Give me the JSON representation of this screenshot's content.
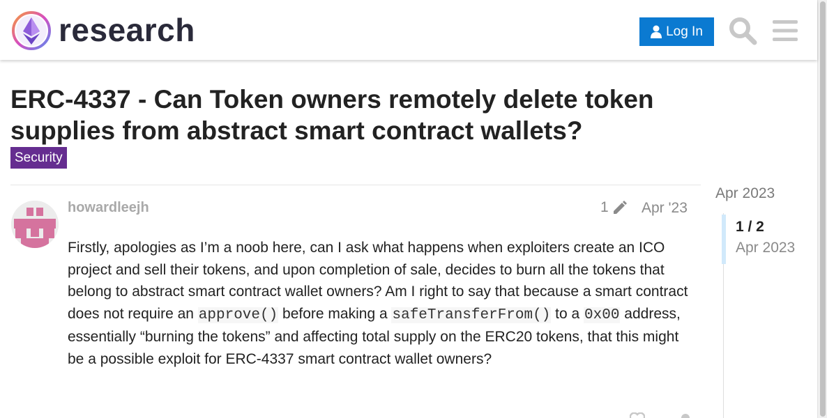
{
  "header": {
    "brand": "research",
    "login_label": "Log In",
    "icons": [
      "ethereum-logo",
      "user-icon",
      "search-icon",
      "hamburger-menu-icon"
    ]
  },
  "topic": {
    "title": "ERC-4337 - Can Token owners remotely delete token supplies from abstract smart contract wallets?",
    "category": "Security",
    "category_color": "#652d90"
  },
  "post": {
    "username": "howardleejh",
    "edit_count": "1",
    "date": "Apr '23",
    "body": {
      "p1": "Firstly, apologies as I’m a noob here, can I ask what happens when exploiters create an ICO project and sell their tokens, and upon completion of sale, decides to burn all the tokens that belong to abstract smart contract wallet owners? Am I right to say that because a smart contract does not require an ",
      "code1": "approve()",
      "p2": " before making a ",
      "code2": "safeTransferFrom()",
      "p3": " to a ",
      "code3": "0x00",
      "p4": " address, essentially “burning the tokens” and affecting total supply on the ERC20 tokens, that this might be a possible exploit for ERC-4337 smart contract wallet owners?"
    }
  },
  "timeline": {
    "start_date": "Apr 2023",
    "position": "1 / 2",
    "current_date": "Apr 2023"
  },
  "colors": {
    "accent": "#0b7ad1",
    "avatar": "#d5739e"
  }
}
